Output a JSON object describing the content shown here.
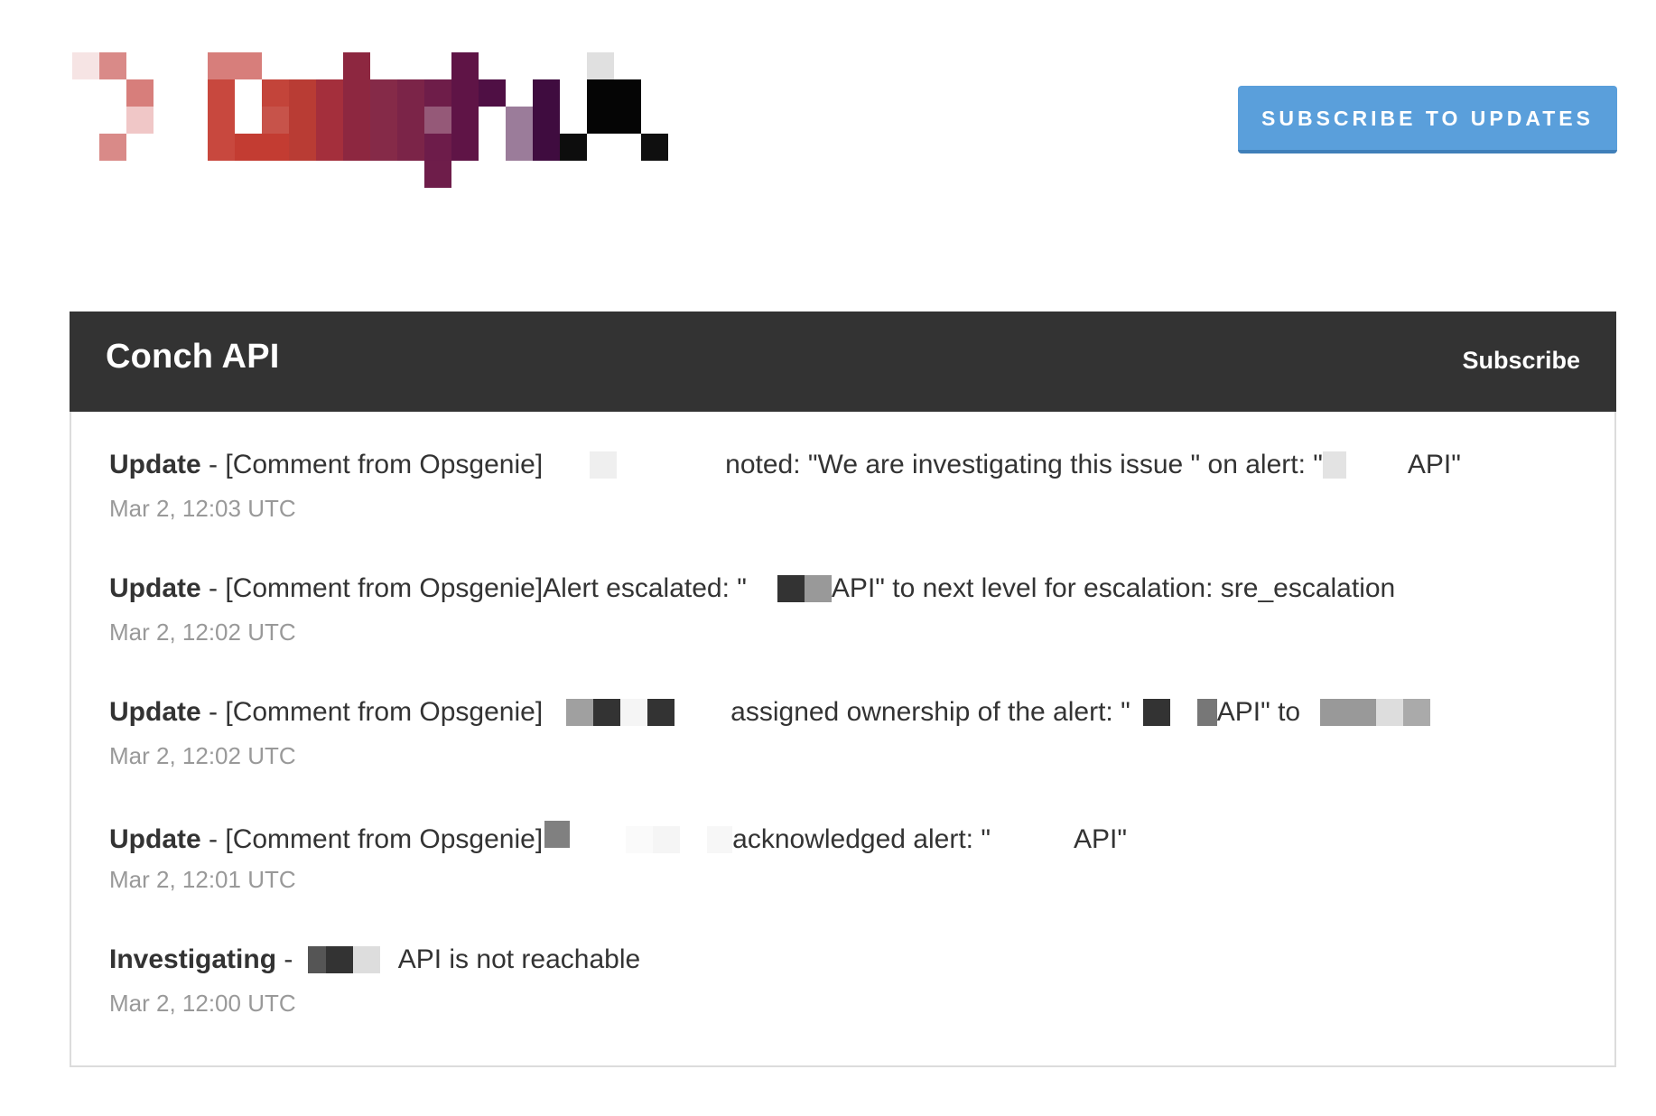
{
  "header": {
    "subscribe_button": "SUBSCRIBE TO UPDATES"
  },
  "panel": {
    "title": "Conch API",
    "subscribe_link": "Subscribe"
  },
  "updates": [
    {
      "status": "Update",
      "sep": " - ",
      "part1": "[Comment from Opsgenie]",
      "part2": "noted: \"We are investigating this issue \" on alert: \"",
      "part3": "API\"",
      "time": "Mar 2, 12:03 UTC"
    },
    {
      "status": "Update",
      "sep": " - ",
      "part1": "[Comment from Opsgenie]Alert escalated: \"",
      "part2": "API\" to next level for escalation: sre_escalation",
      "time": "Mar 2, 12:02 UTC"
    },
    {
      "status": "Update",
      "sep": " - ",
      "part1": "[Comment from Opsgenie]",
      "part2": "assigned ownership of the alert: \"",
      "part3": "API\" to",
      "time": "Mar 2, 12:02 UTC"
    },
    {
      "status": "Update",
      "sep": " - ",
      "part1": "[Comment from Opsgenie]",
      "part2": "acknowledged alert: \"",
      "part3": "API\"",
      "time": "Mar 2, 12:01 UTC"
    },
    {
      "status": "Investigating",
      "sep": " - ",
      "part1": "API is not reachable",
      "time": "Mar 2, 12:00 UTC"
    }
  ],
  "colors": {
    "button": "#5a9fdb",
    "header_bg": "#333333",
    "muted_text": "#999999"
  }
}
